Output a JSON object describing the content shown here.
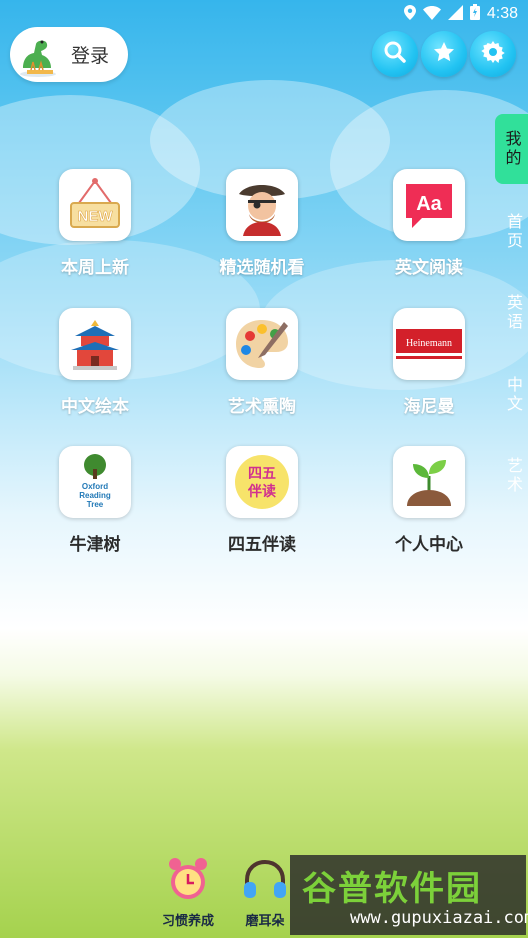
{
  "status_bar": {
    "time": "4:38"
  },
  "header": {
    "login_label": "登录",
    "buttons": [
      {
        "name": "search-button",
        "icon": "search-icon"
      },
      {
        "name": "favorites-button",
        "icon": "star-icon"
      },
      {
        "name": "settings-button",
        "icon": "gear-icon"
      }
    ]
  },
  "side_nav": {
    "active": "我的",
    "items": [
      "首页",
      "英语",
      "中文",
      "艺术"
    ]
  },
  "grid": [
    {
      "label": "本周上新",
      "icon": "new-sign-icon"
    },
    {
      "label": "精选随机看",
      "icon": "pirate-icon"
    },
    {
      "label": "英文阅读",
      "icon": "aa-speech-icon"
    },
    {
      "label": "中文绘本",
      "icon": "pagoda-icon"
    },
    {
      "label": "艺术熏陶",
      "icon": "palette-icon"
    },
    {
      "label": "海尼曼",
      "icon": "heinemann-logo-icon",
      "logo_text": "Heinemann"
    },
    {
      "label": "牛津树",
      "icon": "oxford-tree-icon",
      "logo_text": "Oxford Reading Tree"
    },
    {
      "label": "四五伴读",
      "icon": "siwu-icon",
      "logo_text": "四五伴读"
    },
    {
      "label": "个人中心",
      "icon": "sprout-icon"
    }
  ],
  "bottom": [
    {
      "label": "习惯养成",
      "icon": "alarm-clock-icon"
    },
    {
      "label": "磨耳朵",
      "icon": "headphones-icon"
    }
  ],
  "watermark": {
    "title": "谷普软件园",
    "url": "www.gupuxiazai.com"
  },
  "colors": {
    "accent": "#31e09a",
    "button": "#22c3f2"
  }
}
